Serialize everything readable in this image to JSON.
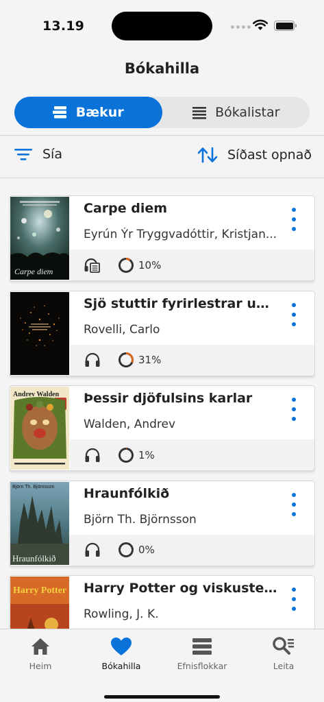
{
  "status_bar": {
    "time": "13.19"
  },
  "header": {
    "title": "Bókahilla"
  },
  "segments": [
    {
      "label": "Bækur",
      "icon": "books-stack-icon",
      "active": true
    },
    {
      "label": "Bókalistar",
      "icon": "list-icon",
      "active": false
    }
  ],
  "filter": {
    "label": "Sía",
    "icon": "filter-icon"
  },
  "sort": {
    "label": "Síðast opnað",
    "icon": "sort-arrows-icon"
  },
  "books": [
    {
      "title": "Carpe diem",
      "author": "Eyrún Ýr Tryggvadóttir, Kristjan...",
      "format": "ebook-audio",
      "progress_label": "10%",
      "progress": 0.1,
      "cover_text": "Carpe diem"
    },
    {
      "title": "Sjö stuttir fyrirlestrar um ...",
      "author": "Rovelli, Carlo",
      "format": "audio",
      "progress_label": "31%",
      "progress": 0.31,
      "cover_text": ""
    },
    {
      "title": "Þessir djöfulsins karlar",
      "author": "Walden, Andrev",
      "format": "audio",
      "progress_label": "1%",
      "progress": 0.01,
      "cover_text": "Andrev Walden"
    },
    {
      "title": "Hraunfólkið",
      "author": "Björn Th. Björnsson",
      "format": "audio",
      "progress_label": "0%",
      "progress": 0.0,
      "cover_text": "Hraunfólkið"
    },
    {
      "title": "Harry Potter og viskustein...",
      "author": "Rowling, J. K.",
      "format": "audio",
      "progress_label": "",
      "progress": 0.0,
      "cover_text": "Harry Potter"
    }
  ],
  "tabs": [
    {
      "label": "Heim",
      "icon": "home-icon",
      "active": false
    },
    {
      "label": "Bókahilla",
      "icon": "heart-icon",
      "active": true
    },
    {
      "label": "Efnisflokkar",
      "icon": "categories-icon",
      "active": false
    },
    {
      "label": "Leita",
      "icon": "search-icon",
      "active": false
    }
  ],
  "colors": {
    "accent": "#0a73d9",
    "progress": "#d9661f",
    "ring_track": "#333333"
  }
}
